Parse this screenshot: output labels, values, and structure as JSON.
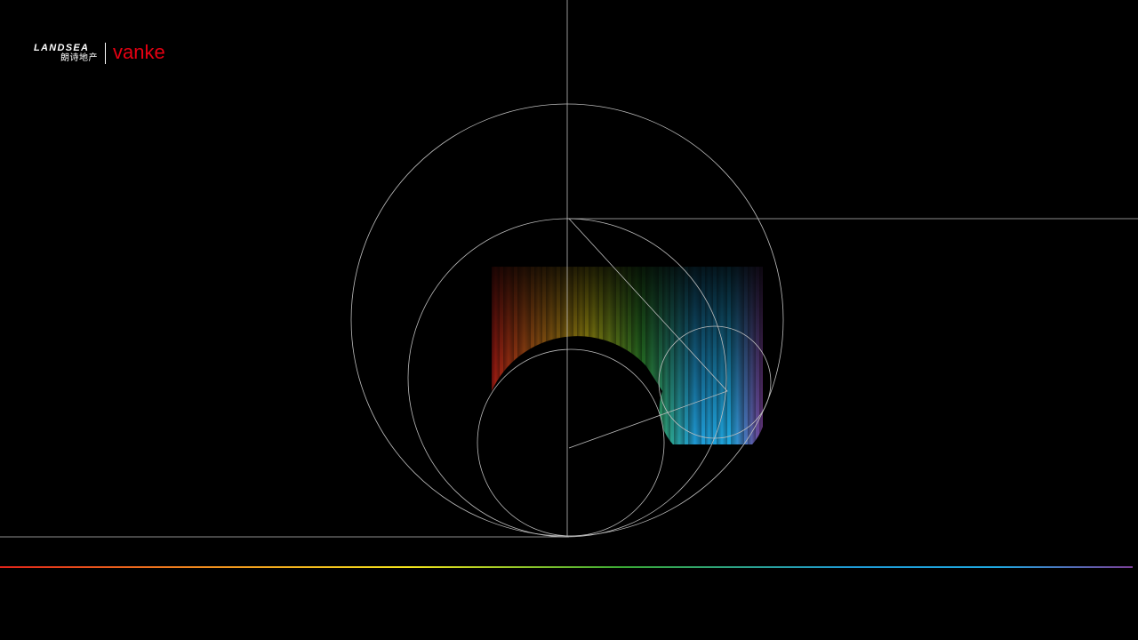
{
  "logo": {
    "landsea_en": "LANDSEA",
    "landsea_cn": "朗诗地产",
    "vanke": "vanke",
    "vanke_color": "#e60012"
  },
  "colors": {
    "background": "#000000",
    "guide_lines": "#bdbdbd",
    "spectrum": [
      "#e2231a",
      "#f08c1e",
      "#f6e61c",
      "#3aaa35",
      "#1f9bd7",
      "#1fa9e1",
      "#7b3f98"
    ]
  }
}
